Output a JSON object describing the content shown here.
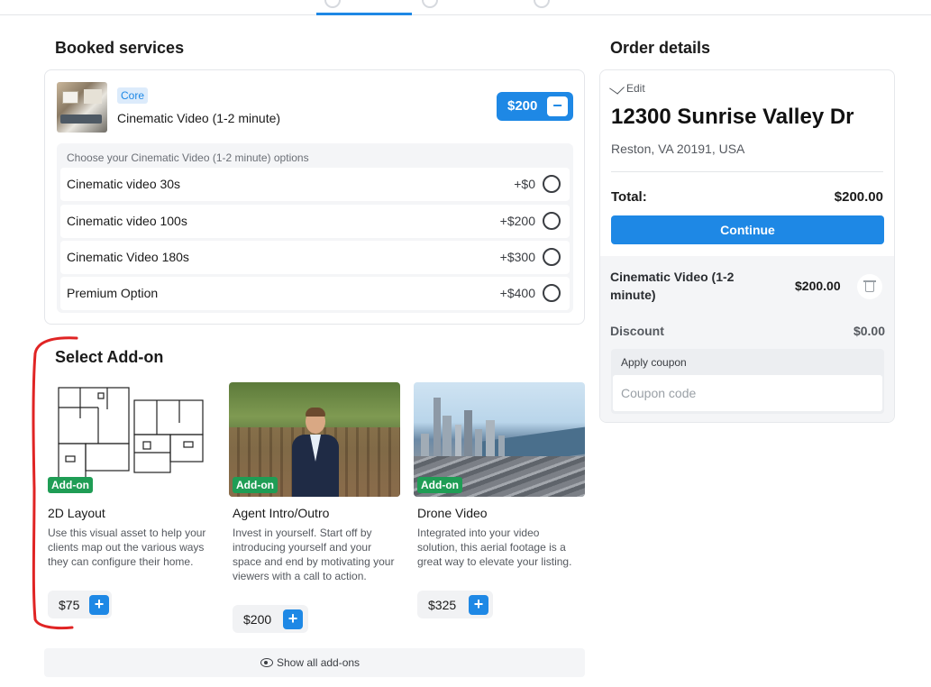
{
  "headers": {
    "booked": "Booked services",
    "order": "Order details",
    "addons": "Select Add-on"
  },
  "booked_service": {
    "badge": "Core",
    "title": "Cinematic Video (1-2 minute)",
    "price": "$200",
    "remove_symbol": "−",
    "options_caption": "Choose your Cinematic Video (1-2 minute) options",
    "options": [
      {
        "name": "Cinematic video 30s",
        "add": "+$0"
      },
      {
        "name": "Cinematic video 100s",
        "add": "+$200"
      },
      {
        "name": "Cinematic Video 180s",
        "add": "+$300"
      },
      {
        "name": "Premium Option",
        "add": "+$400"
      }
    ]
  },
  "addons": [
    {
      "tag": "Add-on",
      "title": "2D Layout",
      "desc": "Use this visual asset to help your clients map out the various ways they can configure their home.",
      "price": "$75",
      "plus": "+"
    },
    {
      "tag": "Add-on",
      "title": "Agent Intro/Outro",
      "desc": "Invest in yourself. Start off by introducing yourself and your space and end by motivating your viewers with a call to action.",
      "price": "$200",
      "plus": "+"
    },
    {
      "tag": "Add-on",
      "title": "Drone Video",
      "desc": "Integrated into your video solution, this aerial footage is a great way to elevate your listing.",
      "price": "$325",
      "plus": "+"
    }
  ],
  "show_all": "Show all add-ons",
  "order": {
    "edit": "Edit",
    "address": "12300 Sunrise Valley Dr",
    "city": "Reston, VA 20191, USA",
    "total_label": "Total:",
    "total_value": "$200.00",
    "continue": "Continue",
    "item_name": "Cinematic Video (1-2 minute)",
    "item_price": "$200.00",
    "discount_label": "Discount",
    "discount_value": "$0.00",
    "coupon_caption": "Apply coupon",
    "coupon_placeholder": "Coupon code"
  },
  "colors": {
    "accent": "#1e88e5",
    "addon_tag": "#1f9d55",
    "annotation": "#e02424"
  }
}
